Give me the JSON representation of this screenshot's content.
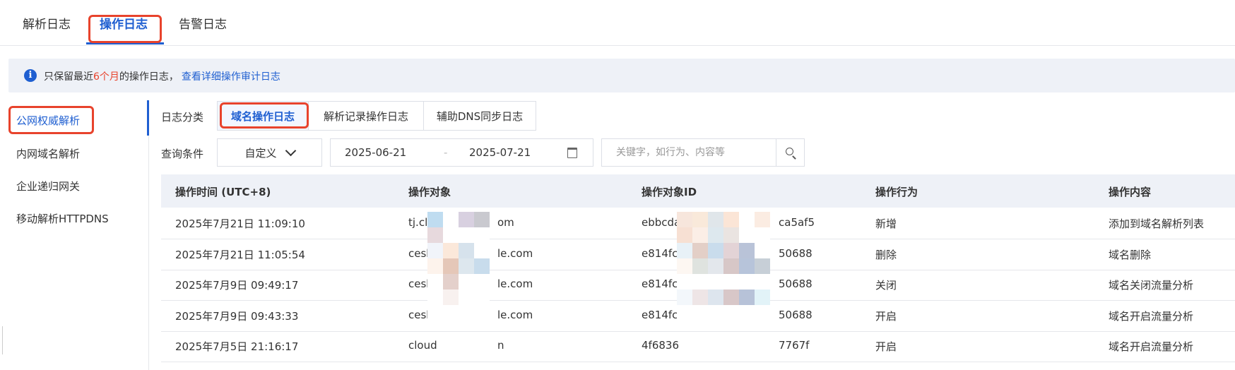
{
  "top_tabs": [
    "解析日志",
    "操作日志",
    "告警日志"
  ],
  "notice": {
    "prefix": "只保留最近",
    "highlight": "6个月",
    "suffix": "的操作日志，",
    "link": "查看详细操作审计日志",
    "icon": "info-icon"
  },
  "sidebar": [
    "公网权威解析",
    "内网域名解析",
    "企业递归网关",
    "移动解析HTTPDNS"
  ],
  "filters": {
    "category_label": "日志分类",
    "categories": [
      "域名操作日志",
      "解析记录操作日志",
      "辅助DNS同步日志"
    ],
    "query_label": "查询条件",
    "time_select": "自定义",
    "date_start": "2025-06-21",
    "date_end": "2025-07-21",
    "search_placeholder": "关键字，如行为、内容等"
  },
  "table": {
    "headers": [
      "操作时间 (UTC+8)",
      "操作对象",
      "操作对象ID",
      "操作行为",
      "操作内容"
    ],
    "rows": [
      {
        "time": "2025年7月21日 11:09:10",
        "object": "tj.clo",
        "object_tail": "om",
        "id": "ebbcda",
        "id_tail": "ca5af5",
        "action": "新增",
        "content": "添加到域名解析列表"
      },
      {
        "time": "2025年7月21日 11:05:54",
        "object": "ceshi",
        "object_tail": "le.com",
        "id": "e814fc",
        "id_tail": "50688",
        "action": "删除",
        "content": "域名删除"
      },
      {
        "time": "2025年7月9日 09:49:17",
        "object": "ceshi",
        "object_tail": "le.com",
        "id": "e814fc9",
        "id_tail": "50688",
        "action": "关闭",
        "content": "域名关闭流量分析"
      },
      {
        "time": "2025年7月9日 09:43:33",
        "object": "ceshi",
        "object_tail": "le.com",
        "id": "e814fc9",
        "id_tail": "50688",
        "action": "开启",
        "content": "域名开启流量分析"
      },
      {
        "time": "2025年7月5日 21:16:17",
        "object": "cloud",
        "object_tail": "n",
        "id": "4f6836",
        "id_tail": "7767f",
        "action": "开启",
        "content": "域名开启流量分析"
      }
    ]
  },
  "colors": {
    "accent": "#1f5fd1",
    "highlight_border": "#e8432c",
    "notice_bg": "#eef1f7"
  }
}
